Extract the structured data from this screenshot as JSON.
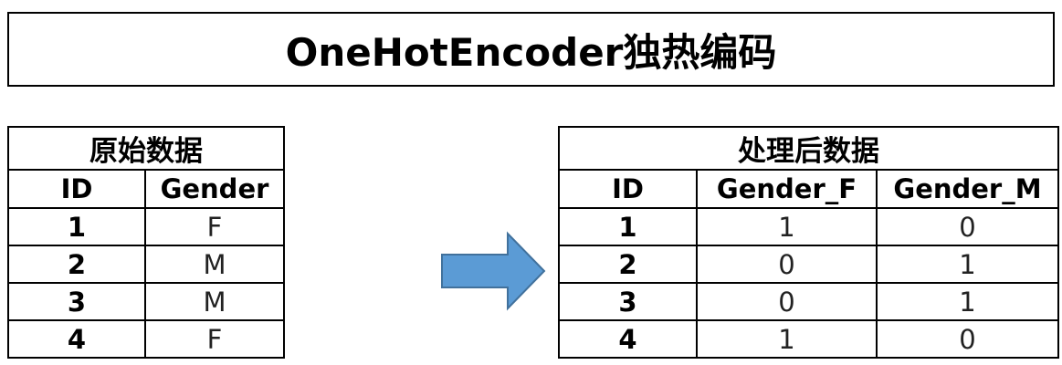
{
  "title": "OneHotEncoder独热编码",
  "colors": {
    "arrow_fill": "#5B9BD5",
    "arrow_stroke": "#41719C"
  },
  "original": {
    "caption": "原始数据",
    "headers": [
      "ID",
      "Gender"
    ],
    "rows": [
      {
        "id": "1",
        "gender": "F"
      },
      {
        "id": "2",
        "gender": "M"
      },
      {
        "id": "3",
        "gender": "M"
      },
      {
        "id": "4",
        "gender": "F"
      }
    ]
  },
  "processed": {
    "caption": "处理后数据",
    "headers": [
      "ID",
      "Gender_F",
      "Gender_M"
    ],
    "rows": [
      {
        "id": "1",
        "gender_f": "1",
        "gender_m": "0"
      },
      {
        "id": "2",
        "gender_f": "0",
        "gender_m": "1"
      },
      {
        "id": "3",
        "gender_f": "0",
        "gender_m": "1"
      },
      {
        "id": "4",
        "gender_f": "1",
        "gender_m": "0"
      }
    ]
  }
}
